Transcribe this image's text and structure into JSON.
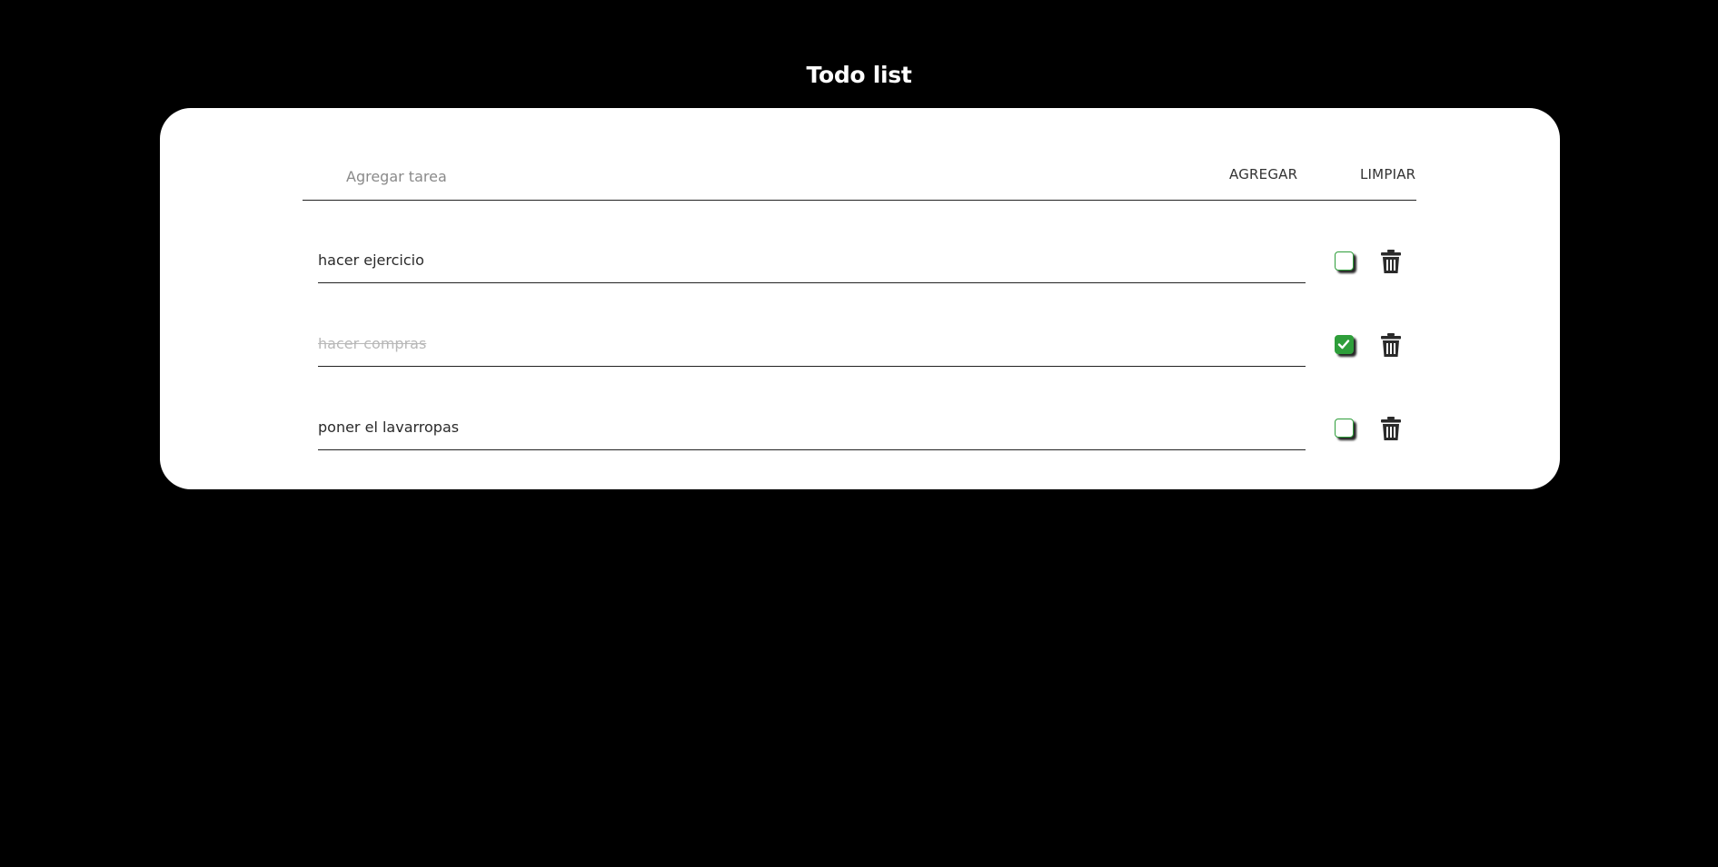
{
  "app": {
    "title": "Todo list"
  },
  "add_form": {
    "placeholder": "Agregar tarea",
    "value": "",
    "add_label": "AGREGAR",
    "clear_label": "LIMPIAR"
  },
  "tasks": [
    {
      "text": "hacer ejercicio",
      "done": false
    },
    {
      "text": "hacer compras",
      "done": true
    },
    {
      "text": "poner el lavarropas",
      "done": false
    }
  ],
  "colors": {
    "background": "#000000",
    "card": "#ffffff",
    "check_accent": "#2e9e3a",
    "trash_icon": "#2a2a2a"
  },
  "icons": {
    "delete": "trash-icon",
    "complete": "checkmark-icon"
  }
}
